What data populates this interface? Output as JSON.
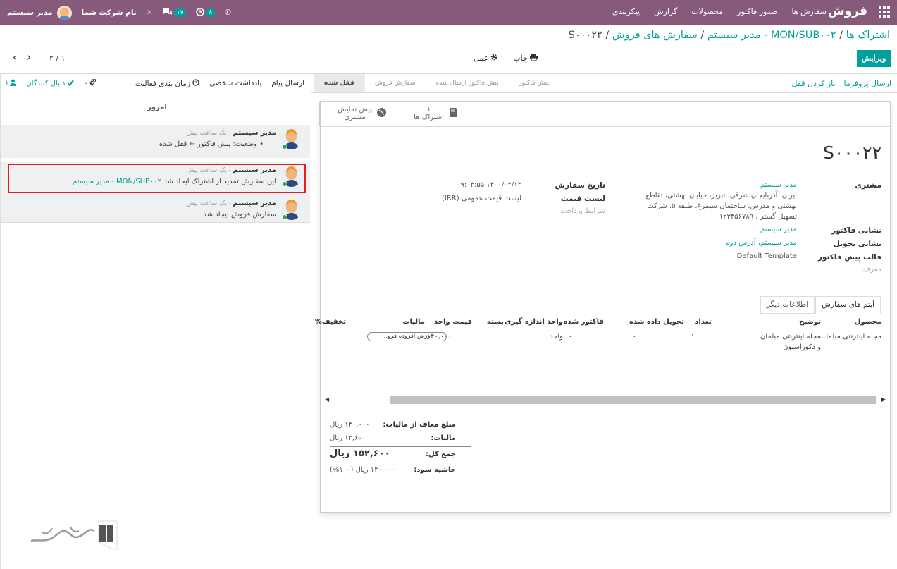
{
  "topbar": {
    "brand": "فروش",
    "menu": [
      "سفارش ها",
      "صدور فاکتور",
      "محصولات",
      "گزارش",
      "پیکربندی"
    ],
    "user_name": "مدیر سیستم",
    "company": "نام شرکت شما",
    "msg_badge": "۱۷",
    "activity_badge": "۸",
    "close_glyph": "✕",
    "phone_glyph": "✆"
  },
  "breadcrumb": {
    "items": [
      "اشتراک ها",
      "MON/SUB۰۰۲ - مدیر سیستم",
      "سفارش های فروش"
    ],
    "current": "S۰۰۰۲۲",
    "sep": " / "
  },
  "toolbar": {
    "edit": "ویرایش",
    "print": "چاپ",
    "action": "عمل",
    "pager": "۲ / ۱",
    "prev": "‹",
    "next": "›"
  },
  "statusbar": {
    "buttons": [
      "ارسال پروفرما",
      "باز کردن قفل"
    ],
    "steps": [
      "پیش فاکتور",
      "پیش فاکتور ارسال شده",
      "سفارش فروش",
      "قفل شده"
    ],
    "active_step": "قفل شده"
  },
  "smart_buttons": {
    "subs_count": "۱",
    "subs_label": "اشتراک ها",
    "preview_line1": "پیش نمایش",
    "preview_line2": "مشتری"
  },
  "form": {
    "title": "S۰۰۰۲۲",
    "customer_label": "مشتری",
    "customer_name": "مدیر سیستم",
    "addr1": "ایران، آذربایجان شرقی، تبریز، خیابان بهشتی، تقاطع",
    "addr2": "بهشتی و مدرس، ساختمان سیمرغ، طبقه ۵، شرکت",
    "addr3": "تسهیل گستر ، ۱۲۳۴۵۶۷۸۹",
    "invoice_addr_label": "نشانی فاکتور",
    "invoice_addr": "مدیر سیستم",
    "delivery_addr_label": "نشانی تحویل",
    "delivery_addr": "مدیر سیستم، آدرس دوم",
    "template_label": "قالب پیش فاکتور",
    "template": "Default Template",
    "referrer": "معرف",
    "order_date_label": "تاریخ سفارش",
    "order_date": "۱۴۰۰/۰۲/۱۲ ۰۹:۰۳:۵۵",
    "pricelist_label": "لیست قیمت",
    "pricelist": "لیست قیمت عمومی (IRR)",
    "payment_terms": "شرایط پرداخت"
  },
  "tabs": [
    "آیتم های سفارش",
    "اطلاعات دیگر"
  ],
  "table": {
    "headers": [
      "محصول",
      "توضیح",
      "تعداد",
      "تحویل داده شده",
      "فاکتور شده",
      "واحد اندازه گیری",
      "بسته",
      "قیمت واحد",
      "مالیات",
      "تخفیف%"
    ],
    "row": {
      "product": "مجله اینترنتی مبلما...",
      "desc1": "مجله اینترنتی مبلمان",
      "desc2": "و دکوراسیون",
      "qty": "۱",
      "delivered": "۰",
      "invoiced": "۰",
      "uom": "واحد",
      "price": "۱۴۰,۰۰۰",
      "tax": "ارزش افزوده فرو..."
    }
  },
  "totals": {
    "untaxed_label": "مبلغ معاف از مالیات:",
    "untaxed": "۱۴۰,۰۰۰ ریال",
    "tax_label": "مالیات:",
    "tax": "۱۲,۶۰۰ ریال",
    "total_label": "جمع کل:",
    "total": "۱۵۲,۶۰۰ ریال",
    "margin_label": "حاشیه سود:",
    "margin": "۱۴۰,۰۰۰ ریال (۱۰۰%)"
  },
  "chatter": {
    "send_message": "ارسال پیام",
    "log_note": "یادداشت شخصی",
    "schedule": "زمان بندی فعالیت",
    "attachments": "۰",
    "follow": "دنبال کنندگان",
    "followers": "۱",
    "today": "امروز",
    "messages": [
      {
        "author": "مدیر سیستم",
        "time": " - یک ساعت پیش",
        "body": "•   وضعیت: پیش فاکتور ← قفل شده"
      },
      {
        "author": "مدیر سیستم",
        "time": " - یک ساعت پیش",
        "body_pre": "این سفارش تمدید از اشتراک ایجاد شد ",
        "body_link": "MON/SUB۰۰۲ - مدیر سیستم"
      },
      {
        "author": "مدیر سیستم",
        "time": " - یک ساعت پیش",
        "body": "سفارش فروش ایجاد شد"
      }
    ]
  }
}
